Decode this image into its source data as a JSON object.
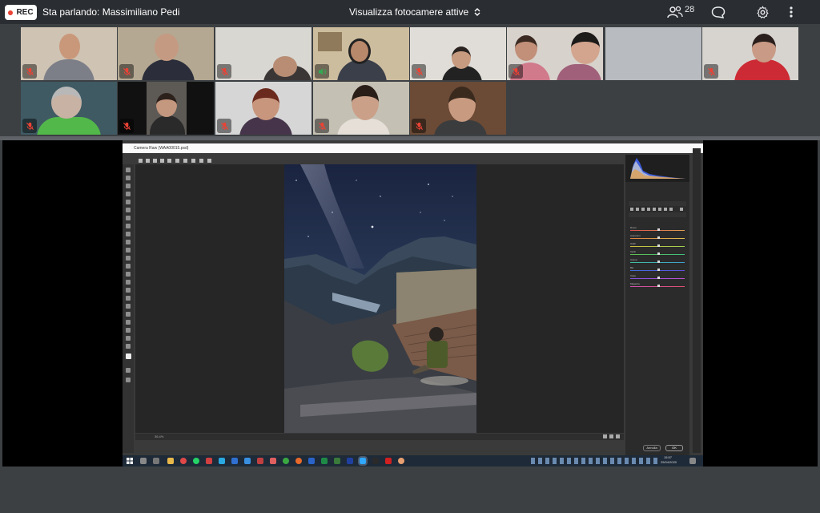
{
  "meeting": {
    "rec_label": "REC",
    "speaker_text": "Sta parlando: Massimiliano Pedi",
    "view_label": "Visualizza fotocamere attive",
    "participants_count": "28"
  },
  "icons": {
    "participants": "people-icon",
    "chat": "chat-bubble-icon",
    "settings": "gear-icon",
    "more": "more-vertical-icon",
    "mic_muted": "mic-off-icon",
    "mic_active": "speaker-icon"
  },
  "colors": {
    "accent_muted_mic": "#ea4335",
    "active_speaker": "#34a853",
    "topbar_bg": "#2a2d31"
  },
  "participant_tiles": [
    {
      "row": 1,
      "muted": true
    },
    {
      "row": 1,
      "muted": true
    },
    {
      "row": 1,
      "muted": true
    },
    {
      "row": 1,
      "muted": false
    },
    {
      "row": 1,
      "muted": true
    },
    {
      "row": 1,
      "muted": true
    },
    {
      "row": 1,
      "muted": true
    },
    {
      "row": 1,
      "muted": true
    },
    {
      "row": 2,
      "muted": true
    },
    {
      "row": 2,
      "muted": true
    },
    {
      "row": 2,
      "muted": true
    },
    {
      "row": 2,
      "muted": true
    },
    {
      "row": 2,
      "muted": true
    }
  ],
  "shared_screen": {
    "app_title": "Camera Raw (WAA00015.psd)",
    "panel_sliders": [
      "Rossi",
      "Arancioni",
      "Gialli",
      "Verdi",
      "Acqua",
      "Blu",
      "Viola",
      "Magenta"
    ],
    "buttons": {
      "cancel": "Annulla",
      "ok": "OK"
    },
    "zoom": "36,4%",
    "clock": {
      "time": "15:57",
      "date": "25/04/2020"
    }
  }
}
